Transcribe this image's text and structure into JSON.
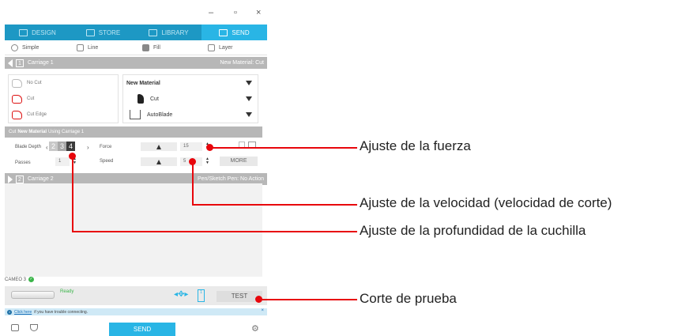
{
  "window": {
    "controls": [
      "–",
      "▫",
      "×"
    ]
  },
  "tabs": [
    {
      "label": "DESIGN",
      "icon": "design-icon",
      "active": false
    },
    {
      "label": "STORE",
      "icon": "store-icon",
      "active": false
    },
    {
      "label": "LIBRARY",
      "icon": "library-icon",
      "active": false
    },
    {
      "label": "SEND",
      "icon": "send-icon",
      "active": true
    }
  ],
  "modes": [
    {
      "label": "Simple"
    },
    {
      "label": "Line"
    },
    {
      "label": "Fill"
    },
    {
      "label": "Layer"
    }
  ],
  "carriage1": {
    "number": "1",
    "label": "Carriage 1",
    "material_right": "New Material: Cut"
  },
  "cut_options": [
    {
      "label": "No Cut"
    },
    {
      "label": "Cut"
    },
    {
      "label": "Cut Edge"
    }
  ],
  "material": {
    "name": "New Material",
    "action": "Cut",
    "tool": "AutoBlade"
  },
  "settings_header": {
    "prefix": "Cut",
    "material": "New Material",
    "suffix": "Using Carriage 1"
  },
  "settings": {
    "blade_depth_label": "Blade Depth",
    "blade_depth_values": [
      "2",
      "3",
      "4"
    ],
    "passes_label": "Passes",
    "passes_value": "1",
    "force_label": "Force",
    "force_value": "15",
    "speed_label": "Speed",
    "speed_value": "5",
    "more_label": "MORE"
  },
  "carriage2": {
    "number": "2",
    "label": "Carriage 2",
    "material_right": "Pen/Sketch Pen: No Action"
  },
  "device": {
    "name": "CAMEO 3",
    "status": "Ready",
    "slot": "1",
    "test_label": "TEST"
  },
  "info": {
    "link": "Click here",
    "text": "if you have trouble connecting."
  },
  "send_label": "SEND",
  "annotations": {
    "force": "Ajuste de la fuerza",
    "speed": "Ajuste de la velocidad (velocidad de corte)",
    "depth": "Ajuste de la profundidad de la cuchilla",
    "test": "Corte de prueba"
  },
  "colors": {
    "accent": "#29b5e5",
    "tab_bar": "#1d98c4",
    "callout": "#e8060c",
    "ready": "#3bb54a"
  }
}
